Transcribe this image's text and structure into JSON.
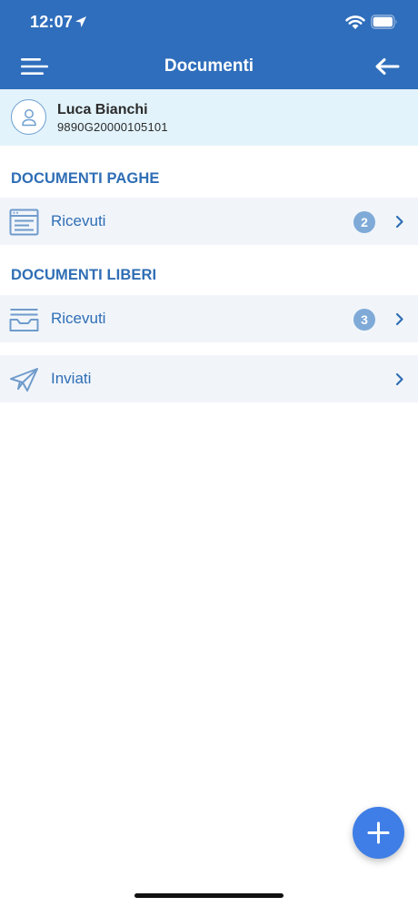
{
  "status_bar": {
    "time": "12:07",
    "icons": [
      "location-arrow-icon",
      "wifi-icon",
      "battery-icon"
    ]
  },
  "header": {
    "title": "Documenti",
    "menu_icon": "menu-icon",
    "back_icon": "back-arrow-icon",
    "color": "#2f6ebc"
  },
  "user": {
    "name": "Luca Bianchi",
    "code": "9890G20000105101",
    "icon": "user-icon"
  },
  "sections": [
    {
      "title": "DOCUMENTI PAGHE",
      "rows": [
        {
          "label": "Ricevuti",
          "badge": "2",
          "icon": "document-list-icon"
        }
      ]
    },
    {
      "title": "DOCUMENTI LIBERI",
      "rows": [
        {
          "label": "Ricevuti",
          "badge": "3",
          "icon": "inbox-tray-icon"
        },
        {
          "label": "Inviati",
          "badge": "",
          "icon": "paper-plane-icon"
        }
      ]
    }
  ],
  "fab": {
    "icon": "plus-icon",
    "color": "#3f7ee6"
  },
  "colors": {
    "accent_text": "#2f6eb5",
    "badge": "#7faad8",
    "user_card_bg": "#e2f3fb",
    "row_bg": "#f1f5fa"
  }
}
